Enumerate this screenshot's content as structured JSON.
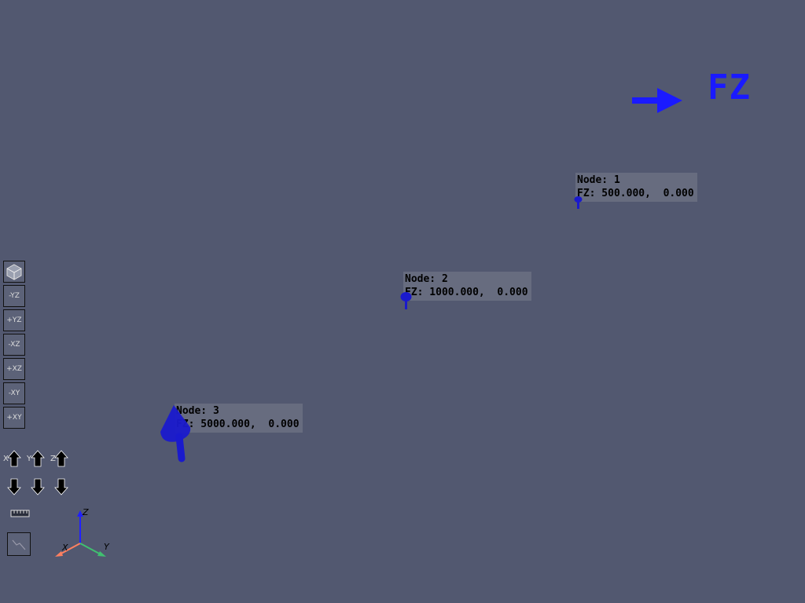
{
  "legend": {
    "label": "FZ",
    "color": "#1a1aff"
  },
  "nodes": [
    {
      "title": "Node: 1",
      "value": "FZ: 500.000,  0.000"
    },
    {
      "title": "Node: 2",
      "value": "FZ: 1000.000,  0.000"
    },
    {
      "title": "Node: 3",
      "value": "FZ: 5000.000,  0.000"
    }
  ],
  "view_buttons": [
    {
      "icon": "isometric-cube-icon",
      "label": ""
    },
    {
      "icon": "view-minus-yz-icon",
      "label": "-YZ"
    },
    {
      "icon": "view-plus-yz-icon",
      "label": "+YZ"
    },
    {
      "icon": "view-minus-xz-icon",
      "label": "-XZ"
    },
    {
      "icon": "view-plus-xz-icon",
      "label": "+XZ"
    },
    {
      "icon": "view-minus-xy-icon",
      "label": "-XY"
    },
    {
      "icon": "view-plus-xy-icon",
      "label": "+XY"
    }
  ],
  "axis_buttons": {
    "up": [
      "X",
      "Y",
      "Z"
    ],
    "down": [
      "",
      "",
      ""
    ]
  },
  "triad": {
    "x": "X",
    "y": "Y",
    "z": "Z"
  },
  "colors": {
    "background": "#525870",
    "arrow": "#1a1acc",
    "x_axis": "#ff8060",
    "y_axis": "#40c070",
    "z_axis": "#2020ff"
  }
}
